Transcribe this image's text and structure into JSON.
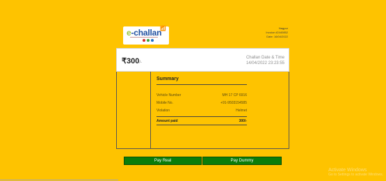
{
  "logo": {
    "e_letter": "e",
    "name_text": "-challan",
    "dot_colors": [
      "#d42b2b",
      "#3aa43a",
      "#1f6fc9"
    ]
  },
  "header": {
    "city": "Nagpur",
    "invoice": "Invoice #2440852",
    "date": "Date: 16/04/2022"
  },
  "amount_bar": {
    "amount": "₹300",
    "amount_suffix": "/-",
    "datetime_label": "Challan Date & Time",
    "datetime_value": "14/04/2022 23:23:55"
  },
  "summary": {
    "title": "Summary",
    "rows": [
      {
        "label": "Vehicle Number",
        "value": "MH 17 CP 6916"
      },
      {
        "label": "Mobile No.",
        "value": "+91-9503154585"
      },
      {
        "label": "Violation",
        "value": "Helmet"
      }
    ],
    "total_label": "Amount paid",
    "total_value": "300/-"
  },
  "buttons": {
    "pay_real": "Pay Real",
    "pay_dummy": "Pay Dummy"
  },
  "watermark": {
    "line1": "Activate Windows",
    "line2": "Go to Settings to activate Windows."
  },
  "colors": {
    "background": "#fec300",
    "button_green": "#0a7d0a",
    "logo_blue": "#1f4fa0"
  }
}
